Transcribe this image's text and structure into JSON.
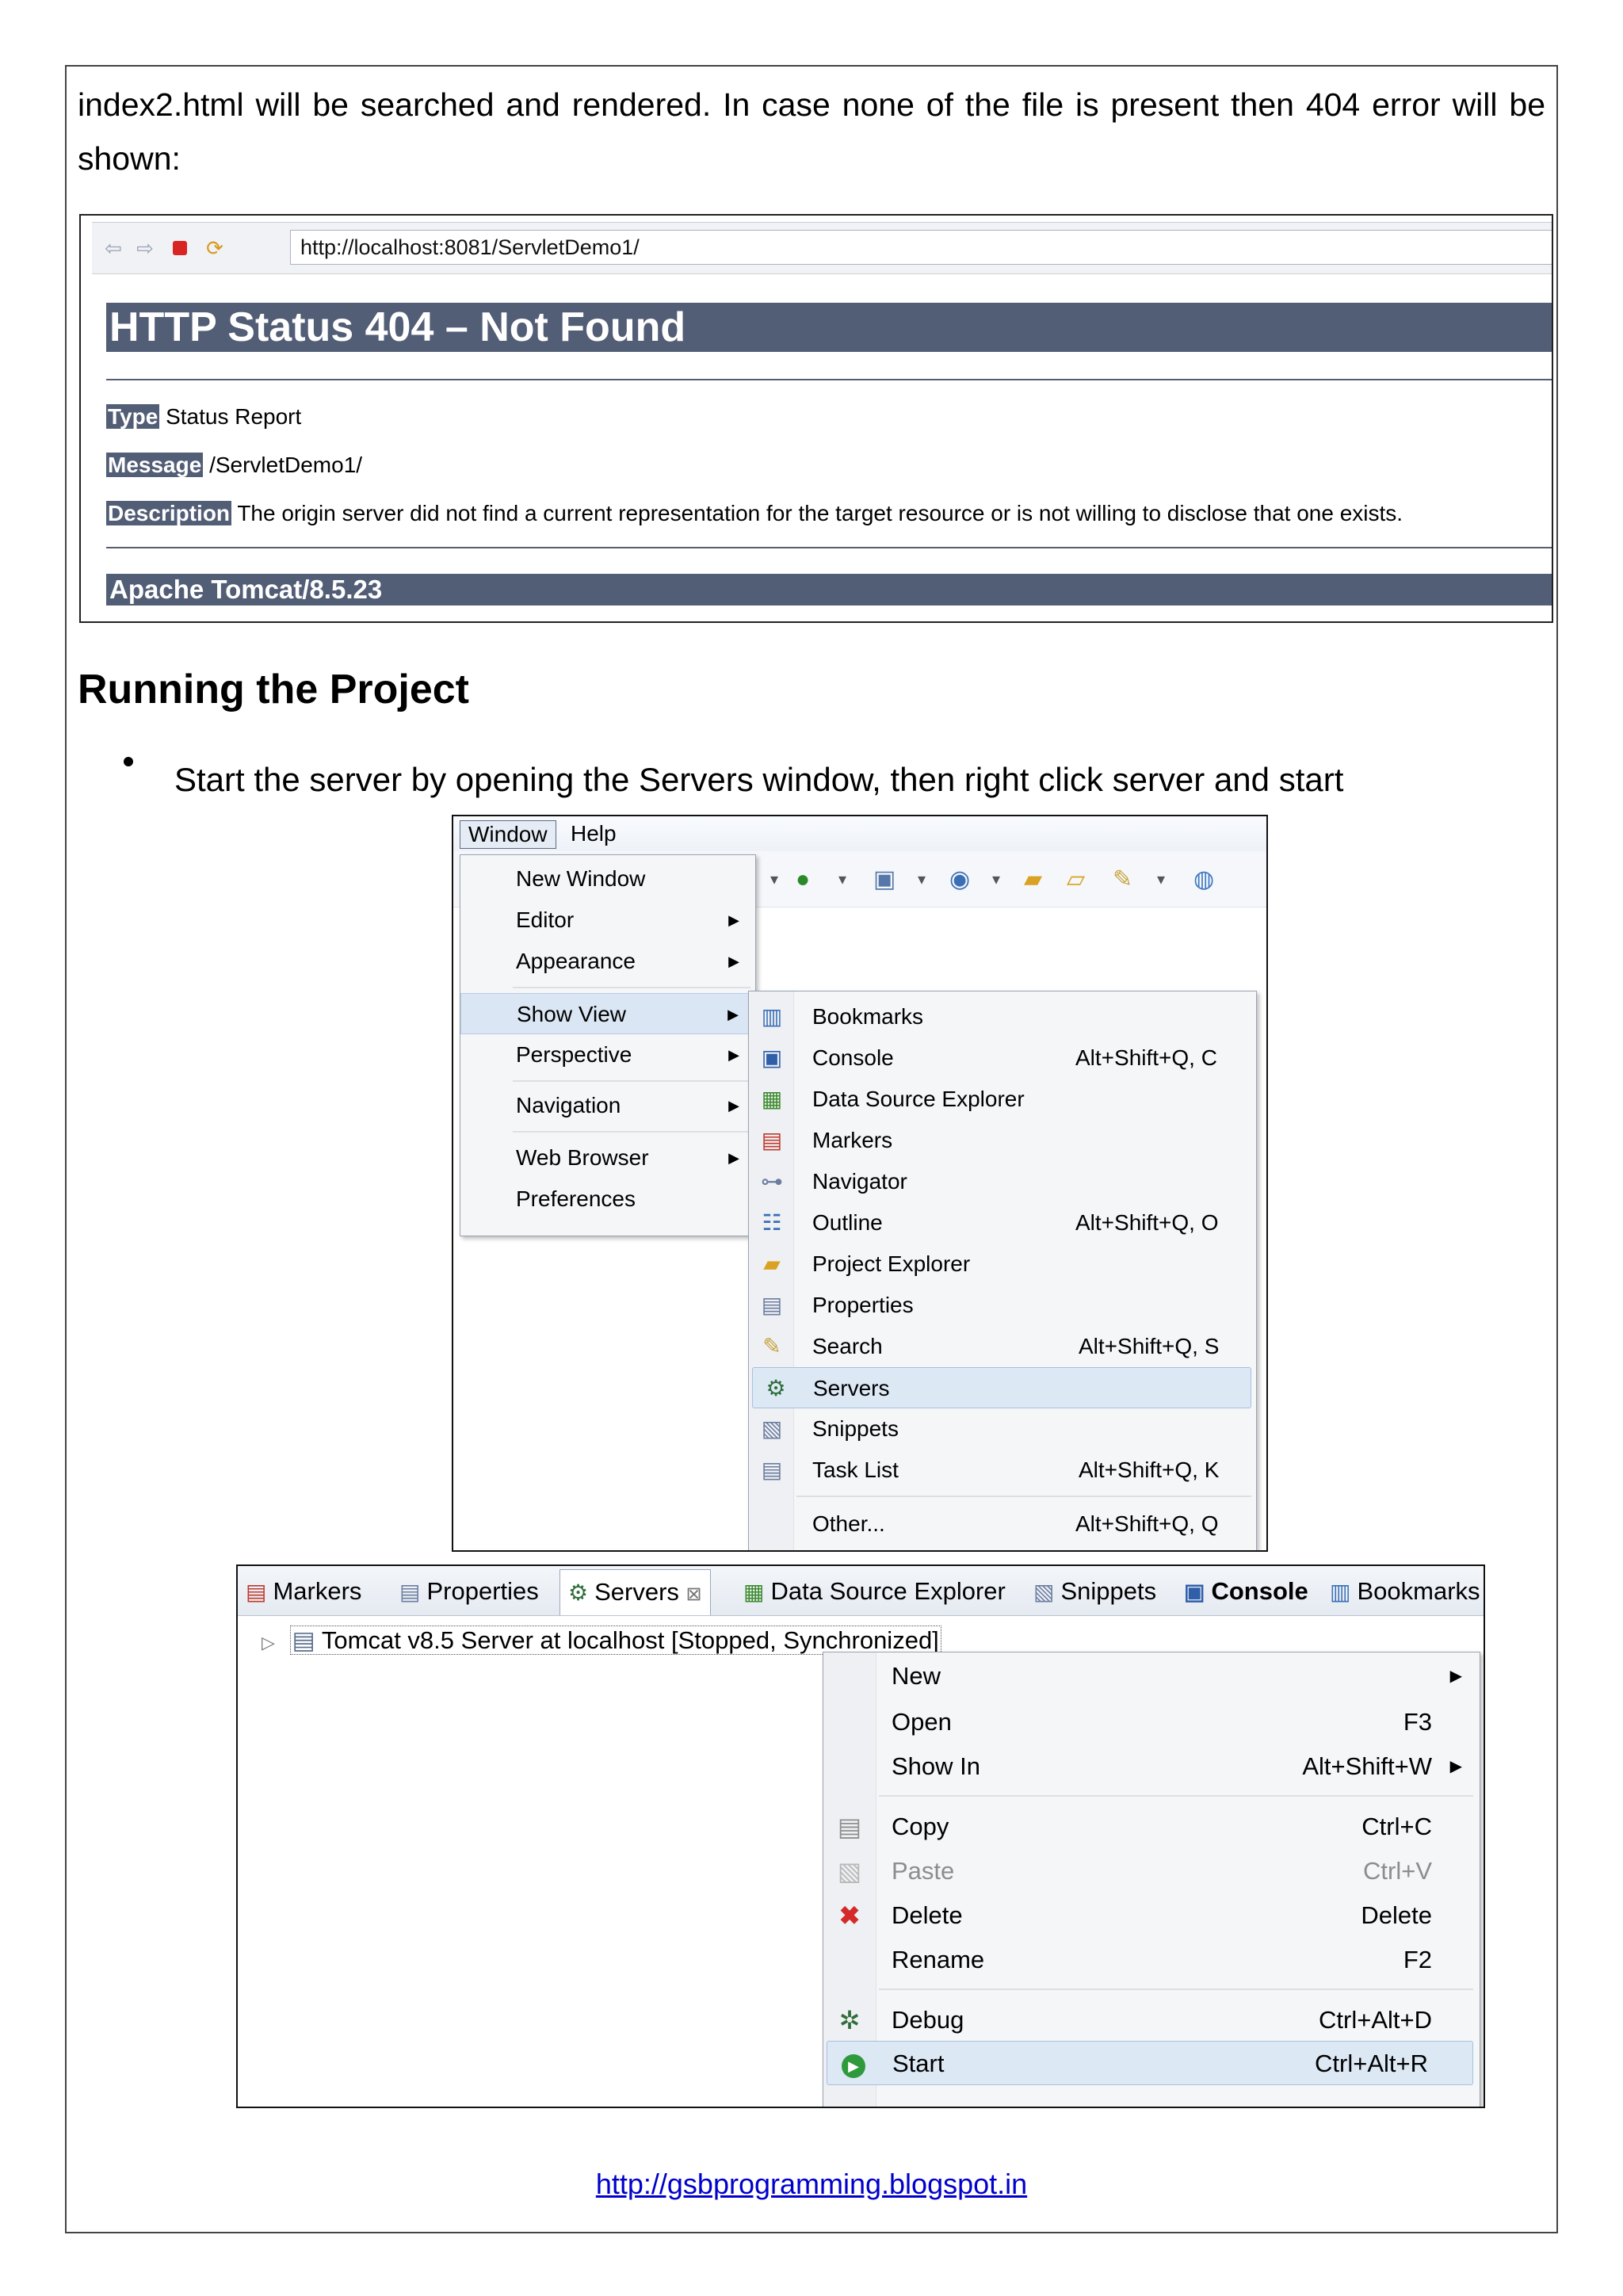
{
  "intro_text": "index2.html will be searched and rendered. In case none of the file is present then 404 error will be shown:",
  "browser": {
    "nav_icons": [
      "back-arrow-icon",
      "forward-arrow-icon",
      "stop-icon",
      "refresh-icon"
    ],
    "url": "http://localhost:8081/ServletDemo1/",
    "status_title": "HTTP Status 404 – Not Found",
    "type_key": "Type",
    "type_value": "Status Report",
    "message_key": "Message",
    "message_value": "/ServletDemo1/",
    "description_key": "Description",
    "description_value": "The origin server did not find a current representation for the target resource or is not willing to disclose that one exists.",
    "footer": "Apache Tomcat/8.5.23",
    "accent_color": "#525d76"
  },
  "section_heading": "Running the Project",
  "bullet_text": "Start the server by opening the Servers window, then right click server and start",
  "eclipse_menu": {
    "menubar": [
      "Window",
      "Help"
    ],
    "window_menu": [
      {
        "label": "New Window",
        "submenu": false
      },
      {
        "label": "Editor",
        "submenu": true
      },
      {
        "label": "Appearance",
        "submenu": true
      },
      {
        "label": "Show View",
        "submenu": true
      },
      {
        "label": "Perspective",
        "submenu": true
      },
      {
        "label": "Navigation",
        "submenu": true
      },
      {
        "label": "Web Browser",
        "submenu": true
      },
      {
        "label": "Preferences",
        "submenu": false
      }
    ],
    "show_view_menu": [
      {
        "label": "Bookmarks",
        "shortcut": "",
        "icon": "bookmarks-icon"
      },
      {
        "label": "Console",
        "shortcut": "Alt+Shift+Q, C",
        "icon": "console-icon"
      },
      {
        "label": "Data Source Explorer",
        "shortcut": "",
        "icon": "data-source-icon"
      },
      {
        "label": "Markers",
        "shortcut": "",
        "icon": "markers-icon"
      },
      {
        "label": "Navigator",
        "shortcut": "",
        "icon": "navigator-icon"
      },
      {
        "label": "Outline",
        "shortcut": "Alt+Shift+Q, O",
        "icon": "outline-icon"
      },
      {
        "label": "Project Explorer",
        "shortcut": "",
        "icon": "project-explorer-icon"
      },
      {
        "label": "Properties",
        "shortcut": "",
        "icon": "properties-icon"
      },
      {
        "label": "Search",
        "shortcut": "Alt+Shift+Q, S",
        "icon": "search-icon"
      },
      {
        "label": "Servers",
        "shortcut": "",
        "icon": "servers-icon"
      },
      {
        "label": "Snippets",
        "shortcut": "",
        "icon": "snippets-icon"
      },
      {
        "label": "Task List",
        "shortcut": "Alt+Shift+Q, K",
        "icon": "task-list-icon"
      },
      {
        "label": "Other...",
        "shortcut": "Alt+Shift+Q, Q",
        "icon": ""
      }
    ]
  },
  "servers_view": {
    "tabs": [
      {
        "label": "Markers",
        "icon": "markers-icon"
      },
      {
        "label": "Properties",
        "icon": "properties-icon"
      },
      {
        "label": "Servers",
        "icon": "servers-icon"
      },
      {
        "label": "Data Source Explorer",
        "icon": "data-source-icon"
      },
      {
        "label": "Snippets",
        "icon": "snippets-icon"
      },
      {
        "label": "Console",
        "icon": "console-icon"
      },
      {
        "label": "Bookmarks",
        "icon": "bookmarks-icon"
      }
    ],
    "server_entry": "Tomcat v8.5 Server at localhost",
    "server_state": "[Stopped, Synchronized]",
    "context_menu": [
      {
        "label": "New",
        "shortcut": "",
        "submenu": true,
        "enabled": true,
        "icon": ""
      },
      {
        "label": "Open",
        "shortcut": "F3",
        "submenu": false,
        "enabled": true,
        "icon": ""
      },
      {
        "label": "Show In",
        "shortcut": "Alt+Shift+W",
        "submenu": true,
        "enabled": true,
        "icon": ""
      },
      {
        "label": "Copy",
        "shortcut": "Ctrl+C",
        "submenu": false,
        "enabled": true,
        "icon": "copy-icon"
      },
      {
        "label": "Paste",
        "shortcut": "Ctrl+V",
        "submenu": false,
        "enabled": false,
        "icon": "paste-icon"
      },
      {
        "label": "Delete",
        "shortcut": "Delete",
        "submenu": false,
        "enabled": true,
        "icon": "delete-icon"
      },
      {
        "label": "Rename",
        "shortcut": "F2",
        "submenu": false,
        "enabled": true,
        "icon": ""
      },
      {
        "label": "Debug",
        "shortcut": "Ctrl+Alt+D",
        "submenu": false,
        "enabled": true,
        "icon": "debug-icon"
      },
      {
        "label": "Start",
        "shortcut": "Ctrl+Alt+R",
        "submenu": false,
        "enabled": true,
        "icon": "start-icon"
      }
    ]
  },
  "footer_link": "http://gsbprogramming.blogspot.in"
}
